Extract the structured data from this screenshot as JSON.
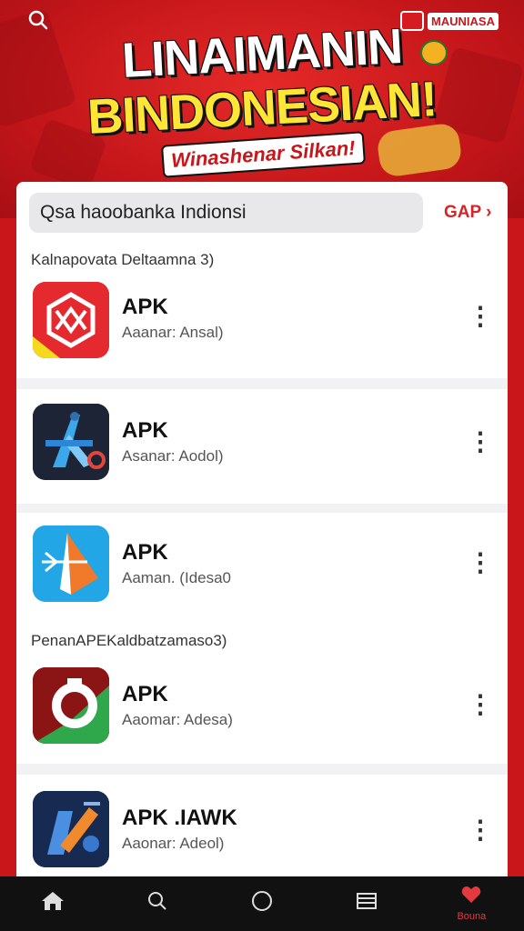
{
  "banner": {
    "headline_line1": "LINAIMANIN",
    "headline_line2": "BINDONESIAN!",
    "tagline": "Winashenar Silkan!",
    "brand_text": "MAUNIASA"
  },
  "search": {
    "value": "Qsa haoobanka Indionsi",
    "action_label": "GAP"
  },
  "sections": [
    {
      "title": "Kalnapovata Deltaamna 3)"
    },
    {
      "title": "PenanAPEKaldbatzamaso3)"
    }
  ],
  "apps": [
    {
      "name": "APK",
      "subtitle": "Aaanar: Ansal)",
      "icon": "red-cube-icon"
    },
    {
      "name": "APK",
      "subtitle": "Asanar: Aodol)",
      "icon": "blue-arrow-icon"
    },
    {
      "name": "APK",
      "subtitle": "Aaman. (Idesa0",
      "icon": "paper-plane-icon"
    },
    {
      "name": "APK",
      "subtitle": "Aaomar: Adesa)",
      "icon": "green-ring-icon"
    },
    {
      "name": "APK .IAWK",
      "subtitle": "Aaonar: Adeol)",
      "icon": "pen-tool-icon"
    }
  ],
  "nav": {
    "items": [
      {
        "icon": "home-icon"
      },
      {
        "icon": "search-icon"
      },
      {
        "icon": "circle-icon"
      },
      {
        "icon": "library-icon"
      },
      {
        "icon": "heart-icon",
        "label": "Bouna"
      }
    ]
  },
  "colors": {
    "brand_red": "#c8161b",
    "accent_yellow": "#ffe536",
    "nav_bg": "#111111"
  }
}
